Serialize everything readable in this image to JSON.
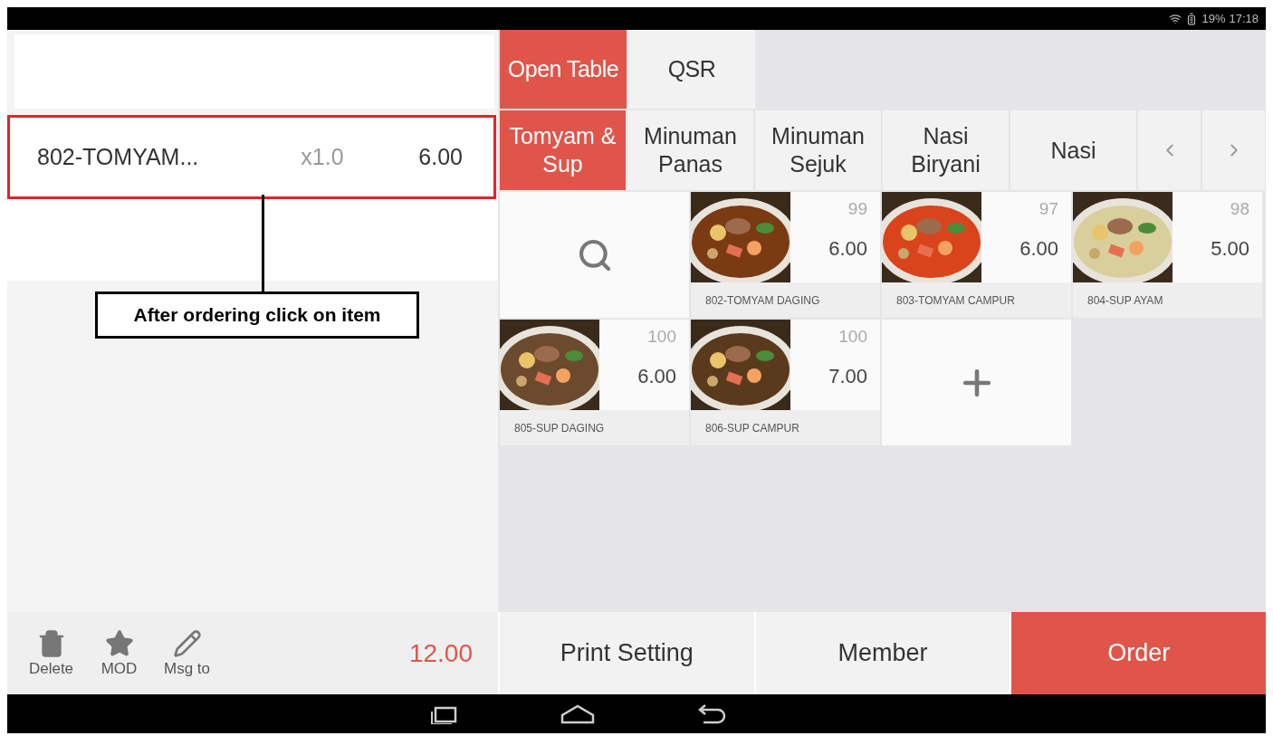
{
  "status_bar": {
    "battery": "19%",
    "time": "17:18"
  },
  "order_items": [
    {
      "name": "802-TOMYAM...",
      "qty": "x1.0",
      "price": "6.00",
      "highlighted": true
    }
  ],
  "annotation": {
    "text": "After ordering click on item"
  },
  "modes": [
    {
      "label": "Open Table",
      "selected": true
    },
    {
      "label": "QSR",
      "selected": false
    }
  ],
  "categories": [
    {
      "label": "Tomyam & Sup",
      "selected": true
    },
    {
      "label": "Minuman Panas",
      "selected": false
    },
    {
      "label": "Minuman Sejuk",
      "selected": false
    },
    {
      "label": "Nasi Biryani",
      "selected": false
    },
    {
      "label": "Nasi",
      "selected": false
    }
  ],
  "menu_items": [
    {
      "kind": "search"
    },
    {
      "kind": "dish",
      "name": "802-TOMYAM DAGING",
      "stock": "99",
      "price": "6.00"
    },
    {
      "kind": "dish",
      "name": "803-TOMYAM CAMPUR",
      "stock": "97",
      "price": "6.00"
    },
    {
      "kind": "dish",
      "name": "804-SUP AYAM",
      "stock": "98",
      "price": "5.00"
    },
    {
      "kind": "dish",
      "name": "805-SUP DAGING",
      "stock": "100",
      "price": "6.00"
    },
    {
      "kind": "dish",
      "name": "806-SUP CAMPUR",
      "stock": "100",
      "price": "7.00"
    },
    {
      "kind": "add"
    }
  ],
  "actions": [
    {
      "kind": "delete",
      "label": "Delete"
    },
    {
      "kind": "mod",
      "label": "MOD"
    },
    {
      "kind": "message",
      "label": "Msg to"
    }
  ],
  "total": "12.00",
  "buttons": [
    {
      "label": "Print Setting",
      "primary": false
    },
    {
      "label": "Member",
      "primary": false
    },
    {
      "label": "Order",
      "primary": true
    }
  ]
}
